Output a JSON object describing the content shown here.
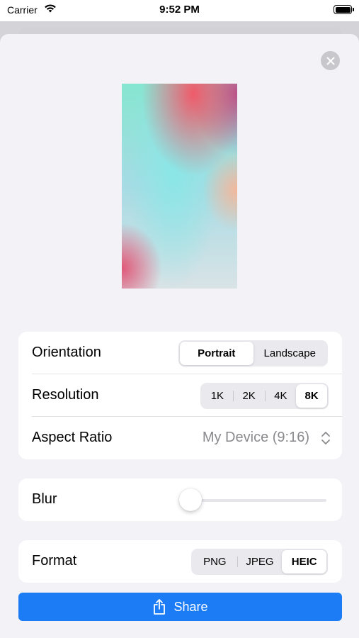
{
  "status_bar": {
    "carrier": "Carrier",
    "time": "9:52 PM"
  },
  "colors": {
    "accent": "#1b7cf5",
    "background": "#f2f2f7",
    "secondary_text": "#8a8a8e"
  },
  "icons": {
    "close": "close-icon",
    "share": "share-icon",
    "updown": "chevron-up-down-icon",
    "wifi": "wifi-icon",
    "battery": "battery-icon"
  },
  "settings": {
    "orientation": {
      "label": "Orientation",
      "options": [
        "Portrait",
        "Landscape"
      ],
      "selected": "Portrait"
    },
    "resolution": {
      "label": "Resolution",
      "options": [
        "1K",
        "2K",
        "4K",
        "8K"
      ],
      "selected": "8K"
    },
    "aspect_ratio": {
      "label": "Aspect Ratio",
      "value": "My Device (9:16)"
    },
    "blur": {
      "label": "Blur",
      "value_fraction": 0.0
    },
    "format": {
      "label": "Format",
      "options": [
        "PNG",
        "JPEG",
        "HEIC"
      ],
      "selected": "HEIC"
    }
  },
  "share_button": {
    "label": "Share"
  }
}
